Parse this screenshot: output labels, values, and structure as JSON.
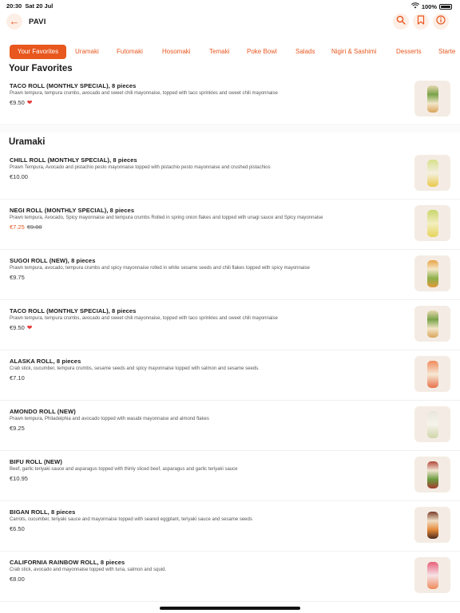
{
  "status": {
    "time": "20:30",
    "date": "Sat 20 Jul",
    "battery": "100%"
  },
  "header": {
    "title": "PAVI"
  },
  "tabs": [
    {
      "label": "Your Favorites",
      "active": true
    },
    {
      "label": "Uramaki"
    },
    {
      "label": "Futomaki"
    },
    {
      "label": "Hosomaki"
    },
    {
      "label": "Temaki"
    },
    {
      "label": "Poke Bowl"
    },
    {
      "label": "Salads"
    },
    {
      "label": "Nigiri & Sashimi"
    },
    {
      "label": "Desserts"
    },
    {
      "label": "Starte"
    }
  ],
  "favorites": {
    "title": "Your Favorites",
    "items": [
      {
        "name": "TACO ROLL (MONTHLY SPECIAL), 8 pieces",
        "desc": "Prawn tempura, tempura crumbs, avocado and sweet chili mayonnaise, topped with taco sprinkles and sweet chili mayonnaise",
        "price": "€9.50",
        "favorite": true
      }
    ]
  },
  "uramaki": {
    "title": "Uramaki",
    "items": [
      {
        "name": "CHILL ROLL (MONTHLY SPECIAL), 8 pieces",
        "desc": "Prawn Tempura, Avocado and pistachio pesto mayonnaise topped with pistachio pesto mayonnaise and crushed pistachios",
        "price": "€10.00"
      },
      {
        "name": "NEGI ROLL (MONTHLY SPECIAL), 8 pieces",
        "desc": "Prawn tempura, Avocado, Spicy mayonnaise and tempura crumbs Rolled in spring onion flakes and topped with unagi sauce and Spicy mayonnaise",
        "price": "€7.25",
        "old_price": "€9.00"
      },
      {
        "name": "SUGOI ROLL (NEW), 8 pieces",
        "desc": "Prawn tempura, avocado, tempura crumbs and spicy mayonnaise rolled in white sesame seeds and chili flakes topped with spicy mayonnaise",
        "price": "€9.75"
      },
      {
        "name": "TACO ROLL (MONTHLY SPECIAL), 8 pieces",
        "desc": "Prawn tempura, tempura crumbs, avocado and sweet chili mayonnaise, topped with taco sprinkles and sweet chili mayonnaise",
        "price": "€9.50",
        "favorite": true
      },
      {
        "name": "ALASKA ROLL, 8 pieces",
        "desc": "Crab stick, cucumber, tempura crumbs, sesame seeds and spicy mayonnaise topped with salmon and sesame seeds.",
        "price": "€7.10"
      },
      {
        "name": "AMONDO ROLL (NEW)",
        "desc": "Prawn tempura, Philadelphia and avocado topped with wasabi mayonnaise and almond flakes",
        "price": "€9.25"
      },
      {
        "name": "BIFU ROLL (NEW)",
        "desc": "Beef, garlic teriyaki sauce and asparagus topped with thinly sliced beef, asparagus and garlic teriyaki sauce",
        "price": "€10.95"
      },
      {
        "name": "BIGAN ROLL, 8 pieces",
        "desc": "Carrots, cucumber, teriyaki sauce and mayonnaise topped with seared eggplant, teriyaki sauce and sesame seeds",
        "price": "€6.50"
      },
      {
        "name": "CALIFORNIA RAINBOW ROLL, 8 pieces",
        "desc": "Crab stick, avocado and mayonnaise topped with tuna, salmon and squid.",
        "price": "€8.00"
      }
    ]
  },
  "colors": {
    "accent": "#e8571e",
    "heart": "#e53935"
  },
  "icons": [
    "back-arrow-icon",
    "search-icon",
    "bookmark-icon",
    "info-icon",
    "heart-icon",
    "wifi-icon",
    "battery-icon"
  ]
}
